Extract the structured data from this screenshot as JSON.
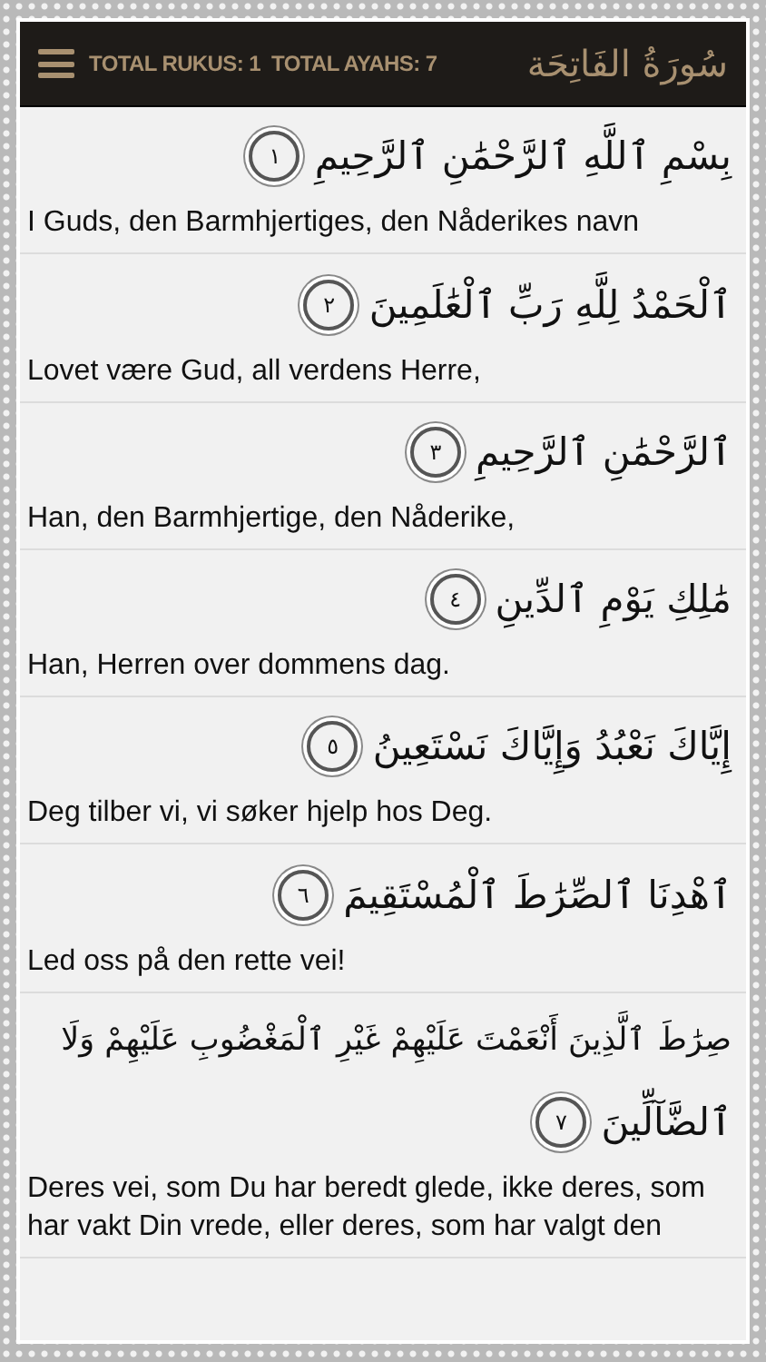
{
  "header": {
    "info": "TOTAL RUKUS: 1  TOTAL AYAHS: 7",
    "surah_title": "سُورَةُ الفَاتِحَة"
  },
  "verses": [
    {
      "arabic_lines": [
        "بِسْمِ ٱللَّهِ ٱلرَّحْمَٰنِ ٱلرَّحِيمِ"
      ],
      "number": "١",
      "translation": "I Guds, den Barmhjertiges, den Nåderikes navn"
    },
    {
      "arabic_lines": [
        "ٱلْحَمْدُ لِلَّهِ رَبِّ ٱلْعَٰلَمِينَ"
      ],
      "number": "٢",
      "translation": "Lovet være Gud, all verdens Herre,"
    },
    {
      "arabic_lines": [
        "ٱلرَّحْمَٰنِ ٱلرَّحِيمِ"
      ],
      "number": "٣",
      "translation": "Han, den Barmhjertige, den Nåderike,"
    },
    {
      "arabic_lines": [
        "مَٰلِكِ يَوْمِ ٱلدِّينِ"
      ],
      "number": "٤",
      "translation": "Han, Herren over dommens dag."
    },
    {
      "arabic_lines": [
        "إِيَّاكَ نَعْبُدُ وَإِيَّاكَ نَسْتَعِينُ"
      ],
      "number": "٥",
      "translation": "Deg tilber vi, vi søker hjelp hos Deg."
    },
    {
      "arabic_lines": [
        "ٱهْدِنَا ٱلصِّرَٰطَ ٱلْمُسْتَقِيمَ"
      ],
      "number": "٦",
      "translation": "Led oss på den rette vei!"
    },
    {
      "arabic_lines": [
        "صِرَٰطَ ٱلَّذِينَ أَنْعَمْتَ عَلَيْهِمْ غَيْرِ ٱلْمَغْضُوبِ عَلَيْهِمْ وَلَا",
        "ٱلضَّآلِّينَ"
      ],
      "number": "٧",
      "translation": "Deres vei, som Du har beredt glede, ikke deres, som har vakt Din vrede, eller deres, som har valgt den"
    }
  ]
}
